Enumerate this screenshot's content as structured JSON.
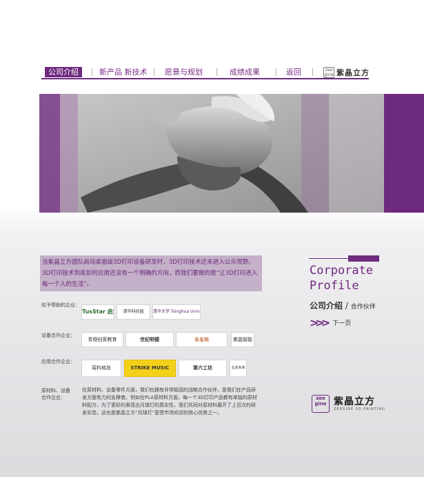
{
  "nav": {
    "items": [
      {
        "label": "公司介绍",
        "active": true
      },
      {
        "label": "新产品 新技术",
        "active": false
      },
      {
        "label": "愿景与规划",
        "active": false
      },
      {
        "label": "成绩成果",
        "active": false
      },
      {
        "label": "返回",
        "active": false
      }
    ],
    "logo_mark": "zee gine",
    "logo_text": "紫晶立方"
  },
  "intro": {
    "text": "当紫晶立方团队启动桌面级3D打印设备研发时，3D打印技术还未进入公众视野。3D打印技术到底如何应用还没有一个明确的方向，而我们要做的是“让3D打印进入每一个人的生活”。"
  },
  "right_panel": {
    "title_line1": "Corporate",
    "title_line2": "Profile",
    "subtitle": "公司介绍",
    "subtitle_small": "合作伙伴",
    "next_label": "下一页"
  },
  "partners": {
    "helpers_label": "给予帮助的企业：",
    "helpers": [
      "TusStar 启迪之星",
      "清华科技园",
      "清华大学 Tsinghua University"
    ],
    "equipment_label": "设备合作企业：",
    "equipment": [
      "青橙创客教育",
      "世纪明德",
      "害羞糖",
      "紫晶智能"
    ],
    "application_label": "应用合作企业：",
    "application": [
      "易料格技",
      "STRIKE MUSIC",
      "第六工坊",
      "北京未来"
    ],
    "materials_label_1": "原材料、设备",
    "materials_label_2": "合作企业：",
    "materials_text": "在原材料、设备零件方面，我们也拥有非常稳固的战略合作伙伴，是我们在产品研发方面有力的支撑者。例如在PLA原材料方面，每一个3D打印产品都有单独的原材料配方，为了更好的表现出月球灯的真实性，我们共同对原材料展开了上百次的研发实验，这也是紫晶立方“月球灯”更受市场欢迎的核心优势之一。"
  },
  "bottom_logo": {
    "mark": "zee gine",
    "name": "紫晶立方",
    "en": "ZEEGINE 3D PRINTING"
  },
  "colors": {
    "accent": "#6e2a7e",
    "intro_bg": "#c4b0c8"
  }
}
